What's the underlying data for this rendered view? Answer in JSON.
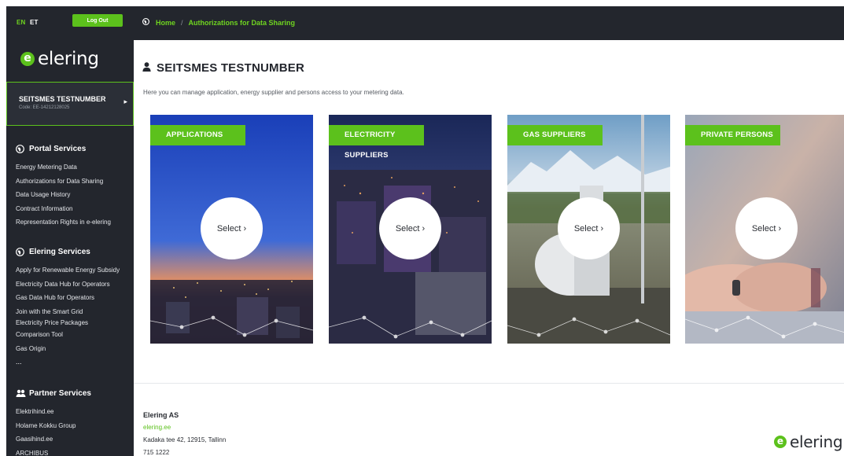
{
  "sidebar": {
    "lang_active": "EN",
    "lang_other": "ET",
    "logout_label": "Log Out",
    "logo_text": "elering",
    "user": {
      "name": "SEITSMES TESTNUMBER",
      "code": "Code: EE-14212128025"
    },
    "sections": [
      {
        "title": "Portal Services",
        "icon": "globe-icon",
        "links": [
          "Energy Metering Data",
          "Authorizations for Data Sharing",
          "Data Usage History",
          "Contract Information",
          "Representation Rights in e-elering"
        ]
      },
      {
        "title": "Elering Services",
        "icon": "globe-icon",
        "links": [
          "Apply for Renewable Energy Subsidy",
          "Electricity Data Hub for Operators",
          "Gas Data Hub for Operators",
          "Join with the Smart Grid",
          "Electricity Price Packages",
          "Comparison Tool",
          "Gas Origin"
        ],
        "more": "..."
      },
      {
        "title": "Partner Services",
        "icon": "handshake-icon",
        "links": [
          "Elektrihind.ee",
          "Holame Kokku Group",
          "Gaasihind.ee",
          "ARCHIBUS"
        ]
      }
    ]
  },
  "breadcrumb": {
    "home": "Home",
    "separator": "/",
    "current": "Authorizations for Data Sharing"
  },
  "main": {
    "title": "SEITSMES TESTNUMBER",
    "description": "Here you can manage application, energy supplier and persons access to your metering data.",
    "cards": [
      {
        "tag": "APPLICATIONS",
        "button": "Select ›"
      },
      {
        "tag": "ELECTRICITY SUPPLIERS",
        "button": "Select ›"
      },
      {
        "tag": "GAS SUPPLIERS",
        "button": "Select ›"
      },
      {
        "tag": "PRIVATE PERSONS",
        "button": "Select ›"
      }
    ]
  },
  "footer": {
    "company": "Elering AS",
    "website": "elering.ee",
    "address": "Kadaka tee 42, 12915, Tallinn",
    "phone": "715 1222",
    "logo_text": "elering"
  },
  "colors": {
    "brand_green": "#5cc11c",
    "sidebar_bg": "#23262d",
    "text_dark": "#23262d"
  }
}
